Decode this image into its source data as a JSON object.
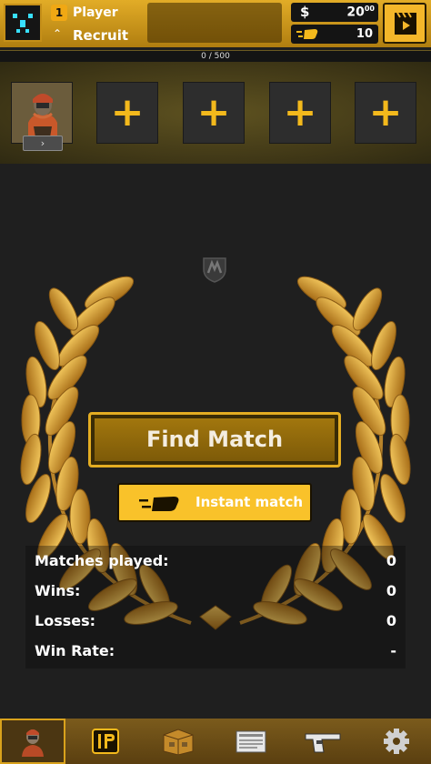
{
  "header": {
    "player_level": "1",
    "player_name": "Player",
    "rank_name": "Recruit",
    "cash_symbol": "$",
    "cash_amount": "20",
    "cash_cents": "00",
    "tokens": "10"
  },
  "xp": {
    "label": "0 / 500",
    "current": 0,
    "max": 500
  },
  "party": {
    "empty_slot_symbol": "+",
    "player_slot_button": "›"
  },
  "matchmaking": {
    "find_match_label": "Find Match",
    "instant_match_label": "Instant match"
  },
  "stats": [
    {
      "label": "Matches played:",
      "value": "0"
    },
    {
      "label": "Wins:",
      "value": "0"
    },
    {
      "label": "Losses:",
      "value": "0"
    },
    {
      "label": "Win Rate:",
      "value": "-"
    }
  ],
  "nav": [
    "profile-icon",
    "ip-icon",
    "case-icon",
    "newspaper-icon",
    "pistol-icon",
    "gear-icon"
  ],
  "colors": {
    "accent": "#f3b91c",
    "background": "#1f1f1f",
    "topbar": "#d8a120"
  }
}
